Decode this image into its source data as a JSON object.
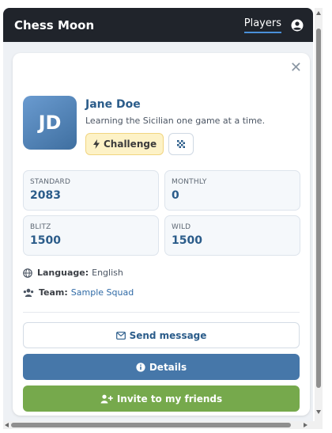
{
  "header": {
    "brand": "Chess Moon",
    "nav_players": "Players",
    "user_icon": "user-circle-icon"
  },
  "profile": {
    "initials": "JD",
    "name": "Jane Doe",
    "bio": "Learning the Sicilian one game at a time.",
    "challenge_label": "Challenge",
    "board_icon": "chessboard-icon"
  },
  "stats": [
    {
      "label": "STANDARD",
      "value": "2083"
    },
    {
      "label": "MONTHLY",
      "value": "0"
    },
    {
      "label": "BLITZ",
      "value": "1500"
    },
    {
      "label": "WILD",
      "value": "1500"
    }
  ],
  "details": {
    "language_label": "Language:",
    "language_value": "English",
    "team_label": "Team:",
    "team_value": "Sample Squad"
  },
  "actions": {
    "send_message": "Send message",
    "details": "Details",
    "invite": "Invite to my friends"
  },
  "colors": {
    "topbar": "#20242b",
    "accent_blue": "#2b5c8a",
    "details_button": "#4677a9",
    "invite_button": "#76a94c",
    "challenge_bg": "#fdf2c7"
  }
}
